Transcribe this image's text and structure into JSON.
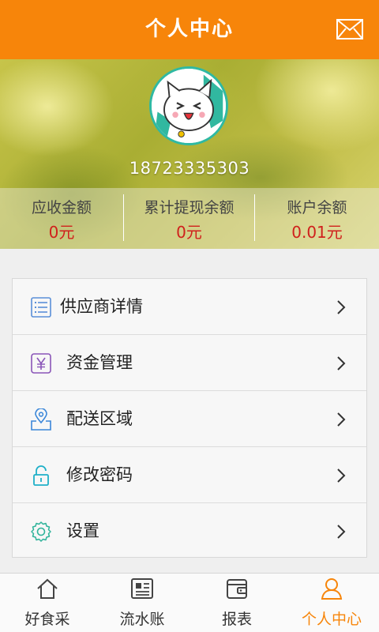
{
  "header": {
    "title": "个人中心",
    "mail_icon": "mail-icon"
  },
  "profile": {
    "phone": "18723335303",
    "avatar_icon": "cat-avatar",
    "stats": [
      {
        "label": "应收金额",
        "value": "0元"
      },
      {
        "label": "累计提现余额",
        "value": "0元"
      },
      {
        "label": "账户余额",
        "value": "0.01元"
      }
    ]
  },
  "menu": {
    "items": [
      {
        "label": "供应商详情",
        "icon": "list-icon"
      },
      {
        "label": "资金管理",
        "icon": "yuan-icon"
      },
      {
        "label": "配送区域",
        "icon": "location-icon"
      },
      {
        "label": "修改密码",
        "icon": "unlock-icon"
      },
      {
        "label": "设置",
        "icon": "gear-icon"
      }
    ]
  },
  "tabbar": {
    "tabs": [
      {
        "label": "好食采",
        "icon": "home-icon"
      },
      {
        "label": "流水账",
        "icon": "newspaper-icon"
      },
      {
        "label": "报表",
        "icon": "wallet-icon"
      },
      {
        "label": "个人中心",
        "icon": "user-icon",
        "active": true
      }
    ]
  },
  "colors": {
    "accent": "#f7850a",
    "value_red": "#d0201c",
    "avatar_ring": "#2fb9a3"
  }
}
